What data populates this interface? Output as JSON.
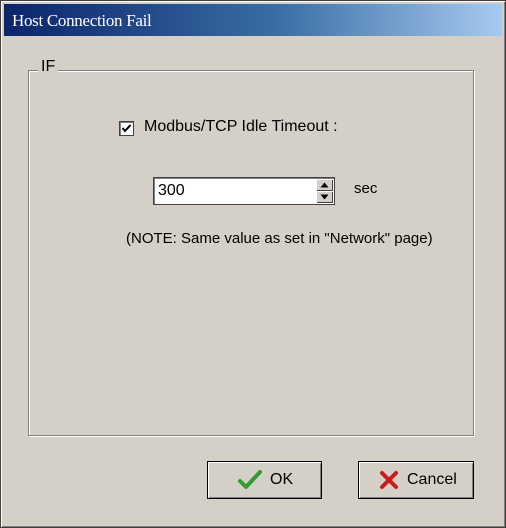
{
  "window": {
    "title": "Host Connection Fail"
  },
  "group": {
    "legend": "IF"
  },
  "idle_timeout": {
    "checkbox_label": "Modbus/TCP Idle Timeout :",
    "checked": true,
    "value": "300",
    "unit": "sec",
    "note": "(NOTE: Same value as set in \"Network\" page)"
  },
  "buttons": {
    "ok_label": "OK",
    "ok_icon": "green-check-icon",
    "cancel_label": "Cancel",
    "cancel_icon": "red-x-icon"
  },
  "colors": {
    "title_start": "#0a246a",
    "title_end": "#a6caf0",
    "ok_icon": "#2e9e2e",
    "cancel_icon": "#cc1a1a"
  }
}
